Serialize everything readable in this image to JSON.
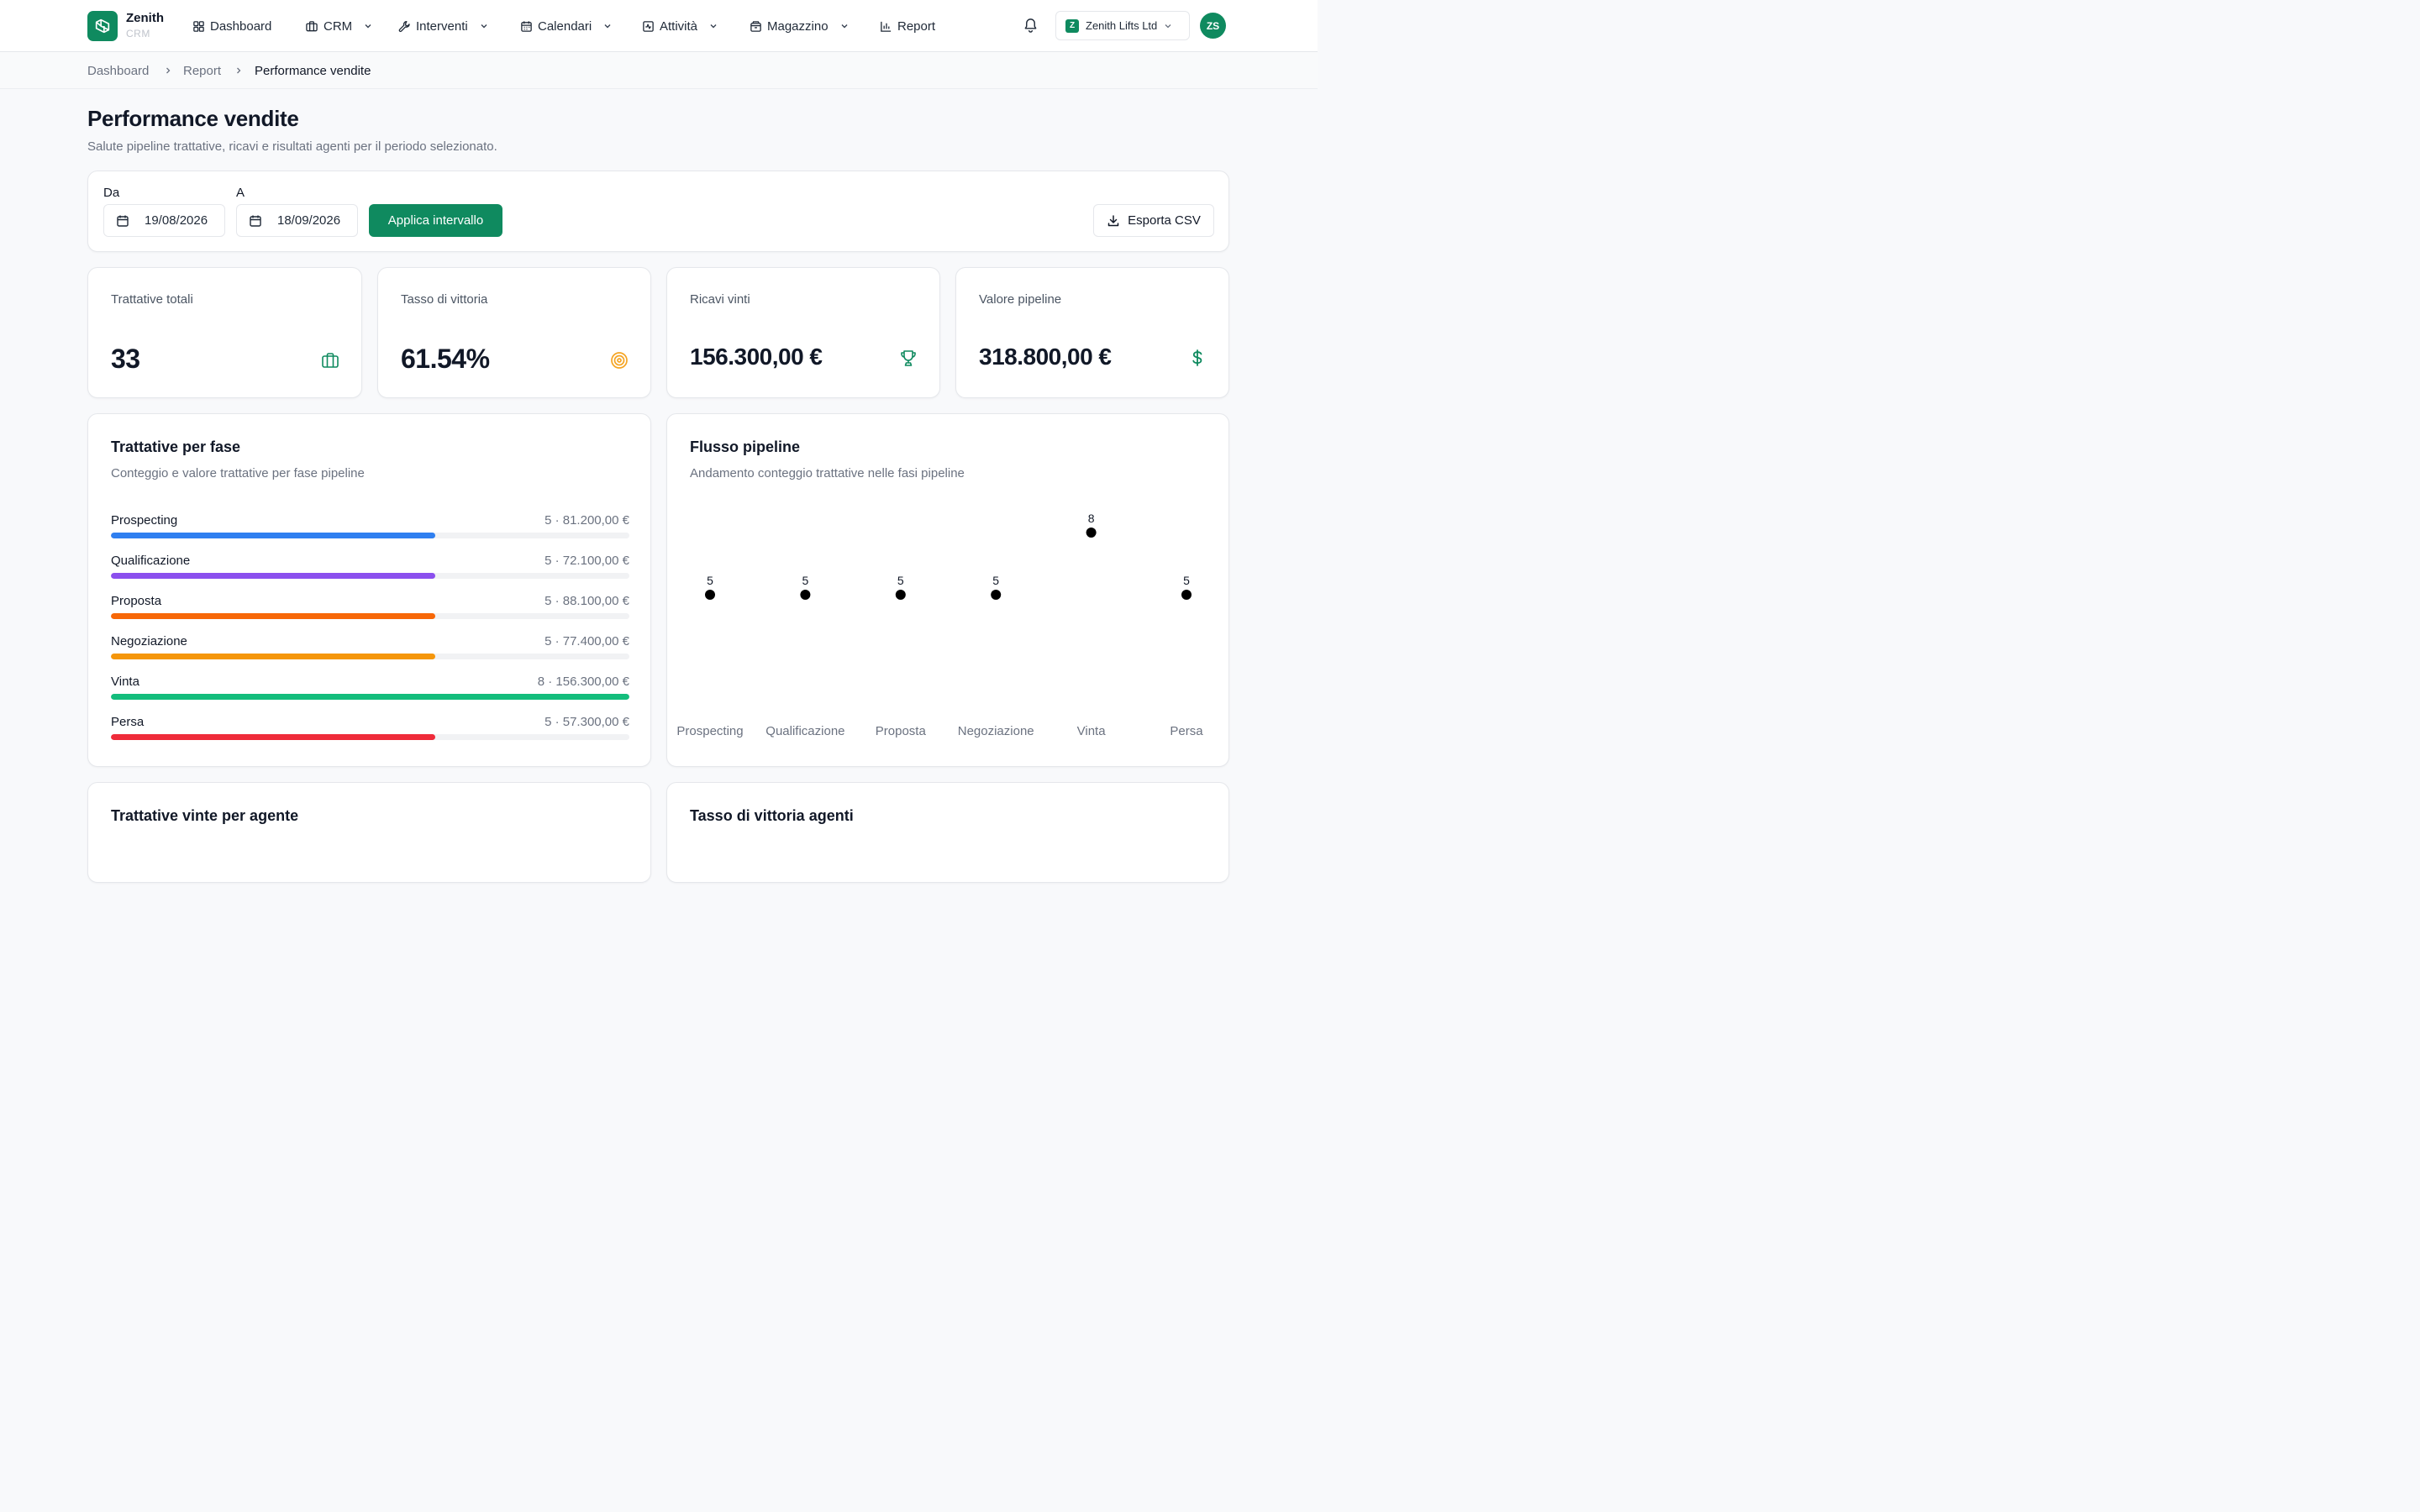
{
  "app": {
    "name": "Zenith",
    "sub": "CRM"
  },
  "nav": {
    "dashboard": "Dashboard",
    "crm": "CRM",
    "interventi": "Interventi",
    "calendari": "Calendari",
    "attivita": "Attività",
    "magazzino": "Magazzino",
    "report": "Report"
  },
  "org": {
    "badge": "Z",
    "name": "Zenith Lifts Ltd"
  },
  "user": {
    "initials": "ZS"
  },
  "breadcrumb": {
    "home": "Dashboard",
    "section": "Report",
    "current": "Performance vendite"
  },
  "page": {
    "title": "Performance vendite",
    "subtitle": "Salute pipeline trattative, ricavi e risultati agenti per il periodo selezionato."
  },
  "filters": {
    "from_label": "Da",
    "from_value": "19/08/2026",
    "to_label": "A",
    "to_value": "18/09/2026",
    "apply_label": "Applica intervallo",
    "export_label": "Esporta CSV"
  },
  "kpis": {
    "total_deals": {
      "label": "Trattative totali",
      "value": "33",
      "icon": "briefcase-icon"
    },
    "win_rate": {
      "label": "Tasso di vittoria",
      "value": "61.54%",
      "icon": "target-icon"
    },
    "revenue_won": {
      "label": "Ricavi vinti",
      "value": "156.300,00 €",
      "icon": "trophy-icon"
    },
    "pipeline_value": {
      "label": "Valore pipeline",
      "value": "318.800,00 €",
      "icon": "dollar-icon"
    }
  },
  "stages_card": {
    "title": "Trattative per fase",
    "subtitle": "Conteggio e valore trattative per fase pipeline",
    "stages": [
      {
        "name": "Prospecting",
        "summary": "5 · 81.200,00 €",
        "count": 5,
        "color": "#2f7ff0"
      },
      {
        "name": "Qualificazione",
        "summary": "5 · 72.100,00 €",
        "count": 5,
        "color": "#8b4fee"
      },
      {
        "name": "Proposta",
        "summary": "5 · 88.100,00 €",
        "count": 5,
        "color": "#f76707"
      },
      {
        "name": "Negoziazione",
        "summary": "5 · 77.400,00 €",
        "count": 5,
        "color": "#f5960b"
      },
      {
        "name": "Vinta",
        "summary": "8 · 156.300,00 €",
        "count": 8,
        "color": "#13bd7c"
      },
      {
        "name": "Persa",
        "summary": "5 · 57.300,00 €",
        "count": 5,
        "color": "#ef2b3a"
      }
    ]
  },
  "flow_card": {
    "title": "Flusso pipeline",
    "subtitle": "Andamento conteggio trattative nelle fasi pipeline"
  },
  "chart_data": {
    "type": "scatter",
    "categories": [
      "Prospecting",
      "Qualificazione",
      "Proposta",
      "Negoziazione",
      "Vinta",
      "Persa"
    ],
    "values": [
      5,
      5,
      5,
      5,
      8,
      5
    ]
  },
  "bottom": {
    "left_title": "Trattative vinte per agente",
    "right_title": "Tasso di vittoria agenti"
  },
  "colors": {
    "accent": "#0f8a5f",
    "kpi_icon_target": "#f5a524"
  }
}
